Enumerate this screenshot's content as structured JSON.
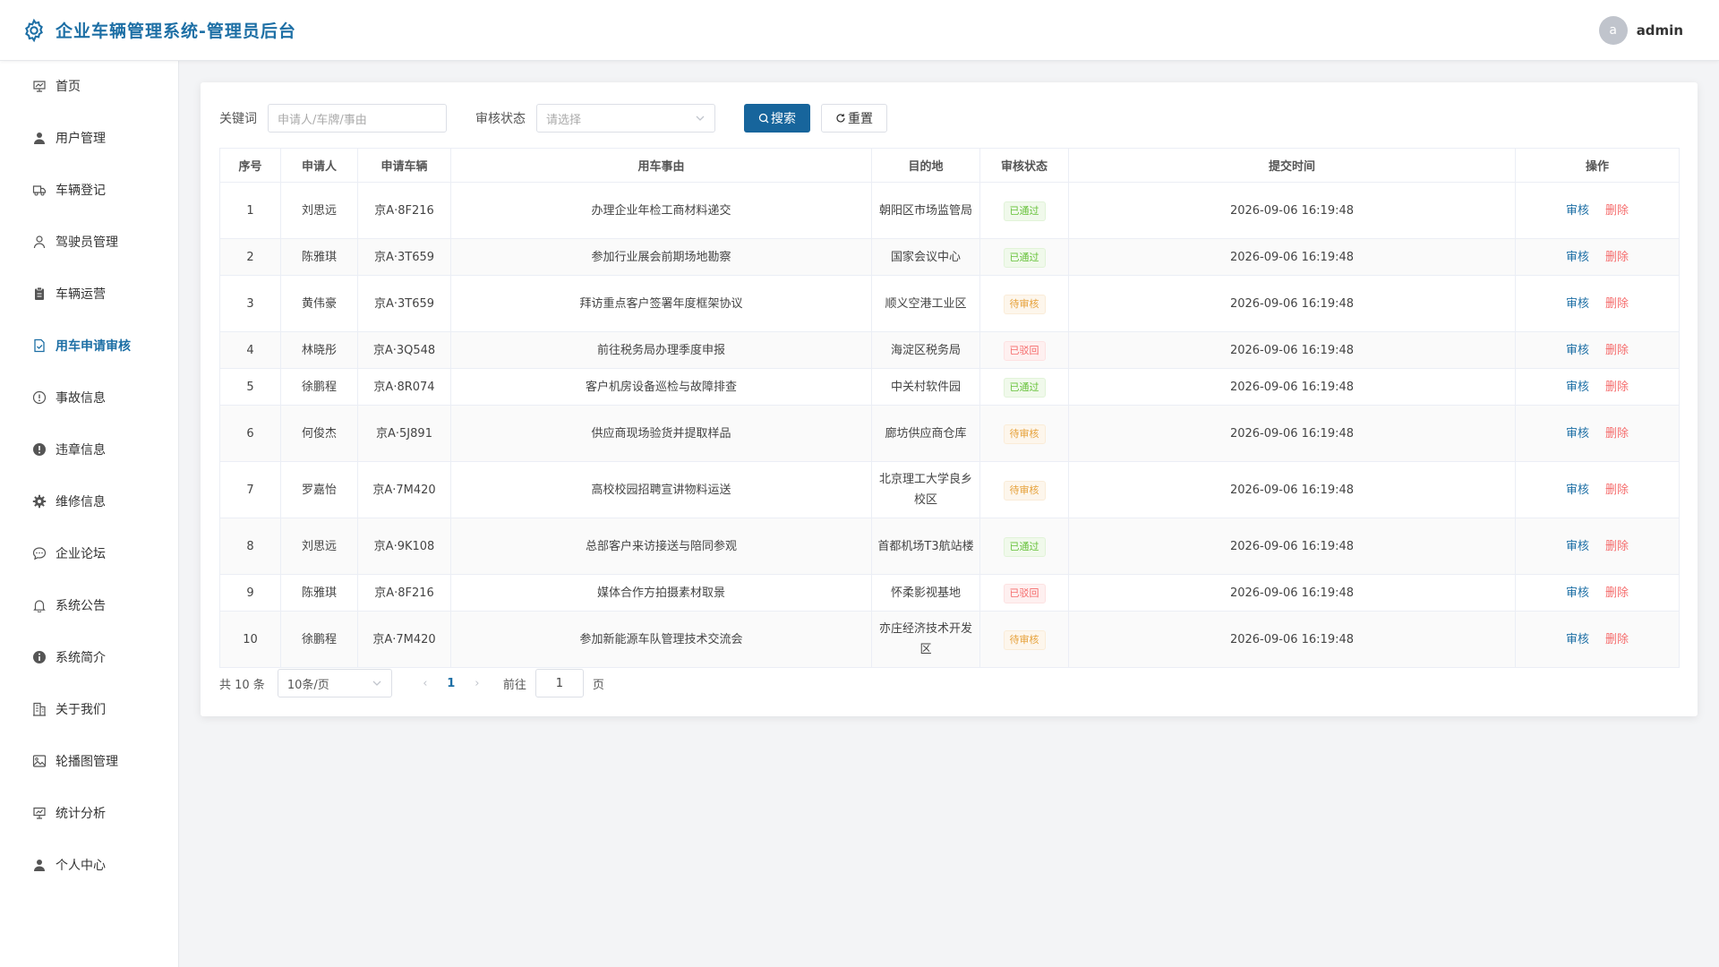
{
  "header": {
    "title": "企业车辆管理系统-管理员后台",
    "avatar_letter": "a",
    "username": "admin",
    "brand_color": "#1d6fa5"
  },
  "sidebar": {
    "items": [
      {
        "label": "首页",
        "icon": "dashboard-icon",
        "active": false
      },
      {
        "label": "用户管理",
        "icon": "user-icon",
        "active": false
      },
      {
        "label": "车辆登记",
        "icon": "truck-icon",
        "active": false
      },
      {
        "label": "驾驶员管理",
        "icon": "person-icon",
        "active": false
      },
      {
        "label": "车辆运营",
        "icon": "clipboard-icon",
        "active": false
      },
      {
        "label": "用车申请审核",
        "icon": "document-check-icon",
        "active": true
      },
      {
        "label": "事故信息",
        "icon": "warning-icon",
        "active": false
      },
      {
        "label": "违章信息",
        "icon": "alert-icon",
        "active": false
      },
      {
        "label": "维修信息",
        "icon": "settings-icon",
        "active": false
      },
      {
        "label": "企业论坛",
        "icon": "chat-icon",
        "active": false
      },
      {
        "label": "系统公告",
        "icon": "bell-icon",
        "active": false
      },
      {
        "label": "系统简介",
        "icon": "info-icon",
        "active": false
      },
      {
        "label": "关于我们",
        "icon": "building-icon",
        "active": false
      },
      {
        "label": "轮播图管理",
        "icon": "image-icon",
        "active": false
      },
      {
        "label": "统计分析",
        "icon": "chart-icon",
        "active": false
      },
      {
        "label": "个人中心",
        "icon": "user-icon",
        "active": false
      }
    ]
  },
  "filters": {
    "keyword_label": "关键词",
    "keyword_placeholder": "申请人/车牌/事由",
    "status_label": "审核状态",
    "status_placeholder": "请选择",
    "search_label": "搜索",
    "reset_label": "重置"
  },
  "table": {
    "columns": [
      "序号",
      "申请人",
      "申请车辆",
      "用车事由",
      "目的地",
      "审核状态",
      "提交时间",
      "操作"
    ],
    "audit_label": "审核",
    "delete_label": "删除",
    "rows": [
      {
        "no": "1",
        "applicant": "刘思远",
        "vehicle": "京A·8F216",
        "reason": "办理企业年检工商材料递交",
        "destination": "朝阳区市场监管局",
        "status": "已通过",
        "status_type": "pass",
        "time": "2026-09-06 16:19:48"
      },
      {
        "no": "2",
        "applicant": "陈雅琪",
        "vehicle": "京A·3T659",
        "reason": "参加行业展会前期场地勘察",
        "destination": "国家会议中心",
        "status": "已通过",
        "status_type": "pass",
        "time": "2026-09-06 16:19:48"
      },
      {
        "no": "3",
        "applicant": "黄伟豪",
        "vehicle": "京A·3T659",
        "reason": "拜访重点客户签署年度框架协议",
        "destination": "顺义空港工业区",
        "status": "待审核",
        "status_type": "pending",
        "time": "2026-09-06 16:19:48"
      },
      {
        "no": "4",
        "applicant": "林晓彤",
        "vehicle": "京A·3Q548",
        "reason": "前往税务局办理季度申报",
        "destination": "海淀区税务局",
        "status": "已驳回",
        "status_type": "reject",
        "time": "2026-09-06 16:19:48"
      },
      {
        "no": "5",
        "applicant": "徐鹏程",
        "vehicle": "京A·8R074",
        "reason": "客户机房设备巡检与故障排查",
        "destination": "中关村软件园",
        "status": "已通过",
        "status_type": "pass",
        "time": "2026-09-06 16:19:48"
      },
      {
        "no": "6",
        "applicant": "何俊杰",
        "vehicle": "京A·5J891",
        "reason": "供应商现场验货并提取样品",
        "destination": "廊坊供应商仓库",
        "status": "待审核",
        "status_type": "pending",
        "time": "2026-09-06 16:19:48"
      },
      {
        "no": "7",
        "applicant": "罗嘉怡",
        "vehicle": "京A·7M420",
        "reason": "高校校园招聘宣讲物料运送",
        "destination": "北京理工大学良乡校区",
        "status": "待审核",
        "status_type": "pending",
        "time": "2026-09-06 16:19:48"
      },
      {
        "no": "8",
        "applicant": "刘思远",
        "vehicle": "京A·9K108",
        "reason": "总部客户来访接送与陪同参观",
        "destination": "首都机场T3航站楼",
        "status": "已通过",
        "status_type": "pass",
        "time": "2026-09-06 16:19:48"
      },
      {
        "no": "9",
        "applicant": "陈雅琪",
        "vehicle": "京A·8F216",
        "reason": "媒体合作方拍摄素材取景",
        "destination": "怀柔影视基地",
        "status": "已驳回",
        "status_type": "reject",
        "time": "2026-09-06 16:19:48"
      },
      {
        "no": "10",
        "applicant": "徐鹏程",
        "vehicle": "京A·7M420",
        "reason": "参加新能源车队管理技术交流会",
        "destination": "亦庄经济技术开发区",
        "status": "待审核",
        "status_type": "pending",
        "time": "2026-09-06 16:19:48"
      }
    ]
  },
  "pagination": {
    "total_text": "共 10 条",
    "page_size": "10条/页",
    "current_page": "1",
    "goto_label": "前往",
    "goto_value": "1",
    "page_suffix": "页"
  }
}
